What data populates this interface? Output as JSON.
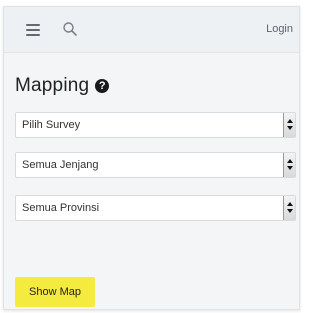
{
  "header": {
    "menu_icon": "hamburger-menu-icon",
    "search_icon": "search-icon",
    "login_label": "Login"
  },
  "page": {
    "title": "Mapping",
    "help_icon": "question-circle-icon",
    "help_symbol": "?"
  },
  "filters": {
    "survey": {
      "selected": "Pilih Survey"
    },
    "jenjang": {
      "selected": "Semua Jenjang"
    },
    "provinsi": {
      "selected": "Semua Provinsi"
    }
  },
  "actions": {
    "show_map_label": "Show Map"
  },
  "colors": {
    "topbar_bg": "#eef1f4",
    "panel_bg": "#f3f5f7",
    "button_accent": "#f5ea3e"
  }
}
